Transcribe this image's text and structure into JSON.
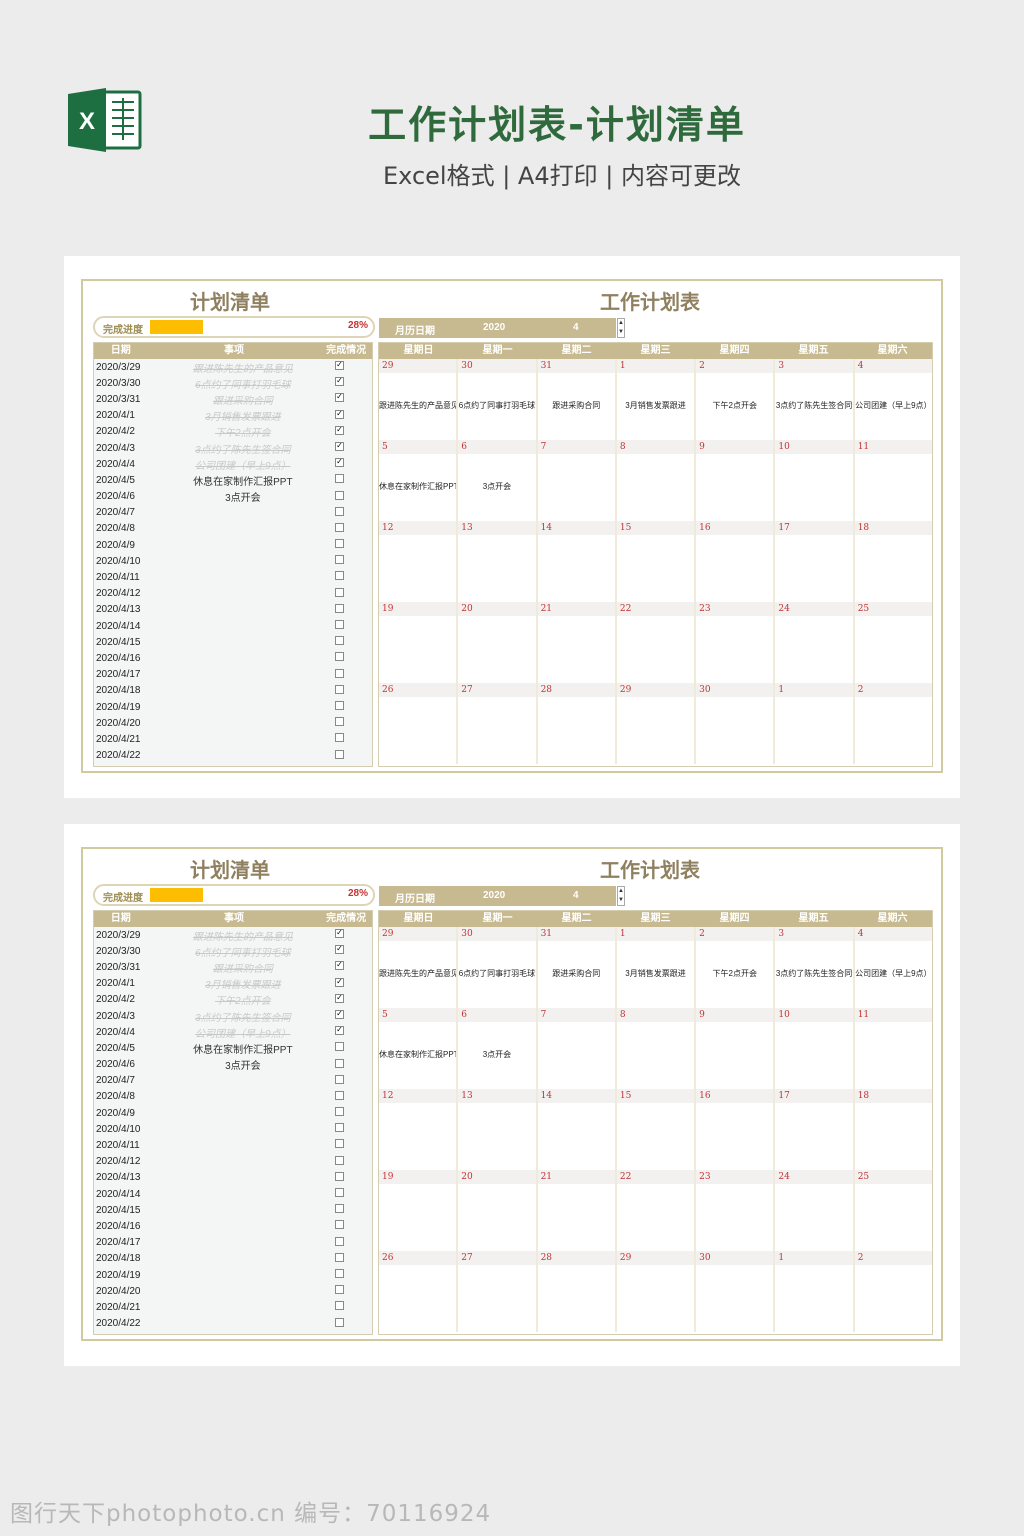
{
  "header": {
    "title": "工作计划表-计划清单",
    "subtitle": "Excel格式 | A4打印 | 内容可更改",
    "logo_icon": "excel-icon",
    "brand_color": "#1d6f42",
    "title_color": "#2e6a3c"
  },
  "watermark": "图行天下photophoto.cn 编号：70116924",
  "sheet": {
    "plan_title": "计划清单",
    "work_title": "工作计划表",
    "progress_label": "完成进度",
    "progress_value": 0.28,
    "progress_text": "28%",
    "month_label": "月历日期",
    "year": "2020",
    "month": "4",
    "plan_headers": [
      "日期",
      "事项",
      "完成情况"
    ],
    "weekdays": [
      "星期日",
      "星期一",
      "星期二",
      "星期三",
      "星期四",
      "星期五",
      "星期六"
    ],
    "rows": [
      {
        "date": "2020/3/29",
        "item": "跟进陈先生的产品意见",
        "done": true
      },
      {
        "date": "2020/3/30",
        "item": "6点约了同事打羽毛球",
        "done": true
      },
      {
        "date": "2020/3/31",
        "item": "跟进采购合同",
        "done": true
      },
      {
        "date": "2020/4/1",
        "item": "3月销售发票跟进",
        "done": true
      },
      {
        "date": "2020/4/2",
        "item": "下午2点开会",
        "done": true
      },
      {
        "date": "2020/4/3",
        "item": "3点约了陈先生签合同",
        "done": true
      },
      {
        "date": "2020/4/4",
        "item": "公司团建（早上9点）",
        "done": true
      },
      {
        "date": "2020/4/5",
        "item": "休息在家制作汇报PPT",
        "done": false
      },
      {
        "date": "2020/4/6",
        "item": "3点开会",
        "done": false
      },
      {
        "date": "2020/4/7",
        "item": "",
        "done": false
      },
      {
        "date": "2020/4/8",
        "item": "",
        "done": false
      },
      {
        "date": "2020/4/9",
        "item": "",
        "done": false
      },
      {
        "date": "2020/4/10",
        "item": "",
        "done": false
      },
      {
        "date": "2020/4/11",
        "item": "",
        "done": false
      },
      {
        "date": "2020/4/12",
        "item": "",
        "done": false
      },
      {
        "date": "2020/4/13",
        "item": "",
        "done": false
      },
      {
        "date": "2020/4/14",
        "item": "",
        "done": false
      },
      {
        "date": "2020/4/15",
        "item": "",
        "done": false
      },
      {
        "date": "2020/4/16",
        "item": "",
        "done": false
      },
      {
        "date": "2020/4/17",
        "item": "",
        "done": false
      },
      {
        "date": "2020/4/18",
        "item": "",
        "done": false
      },
      {
        "date": "2020/4/19",
        "item": "",
        "done": false
      },
      {
        "date": "2020/4/20",
        "item": "",
        "done": false
      },
      {
        "date": "2020/4/21",
        "item": "",
        "done": false
      },
      {
        "date": "2020/4/22",
        "item": "",
        "done": false
      }
    ],
    "calendar": [
      [
        {
          "day": "29",
          "note": "跟进陈先生的产品意见"
        },
        {
          "day": "30",
          "note": "6点约了同事打羽毛球"
        },
        {
          "day": "31",
          "note": "跟进采购合同"
        },
        {
          "day": "1",
          "note": "3月销售发票跟进"
        },
        {
          "day": "2",
          "note": "下午2点开会"
        },
        {
          "day": "3",
          "note": "3点约了陈先生签合同"
        },
        {
          "day": "4",
          "note": "公司团建（早上9点）"
        }
      ],
      [
        {
          "day": "5",
          "note": "休息在家制作汇报PPT"
        },
        {
          "day": "6",
          "note": "3点开会"
        },
        {
          "day": "7",
          "note": ""
        },
        {
          "day": "8",
          "note": ""
        },
        {
          "day": "9",
          "note": ""
        },
        {
          "day": "10",
          "note": ""
        },
        {
          "day": "11",
          "note": ""
        }
      ],
      [
        {
          "day": "12",
          "note": ""
        },
        {
          "day": "13",
          "note": ""
        },
        {
          "day": "14",
          "note": ""
        },
        {
          "day": "15",
          "note": ""
        },
        {
          "day": "16",
          "note": ""
        },
        {
          "day": "17",
          "note": ""
        },
        {
          "day": "18",
          "note": ""
        }
      ],
      [
        {
          "day": "19",
          "note": ""
        },
        {
          "day": "20",
          "note": ""
        },
        {
          "day": "21",
          "note": ""
        },
        {
          "day": "22",
          "note": ""
        },
        {
          "day": "23",
          "note": ""
        },
        {
          "day": "24",
          "note": ""
        },
        {
          "day": "25",
          "note": ""
        }
      ],
      [
        {
          "day": "26",
          "note": ""
        },
        {
          "day": "27",
          "note": ""
        },
        {
          "day": "28",
          "note": ""
        },
        {
          "day": "29",
          "note": ""
        },
        {
          "day": "30",
          "note": ""
        },
        {
          "day": "1",
          "note": ""
        },
        {
          "day": "2",
          "note": ""
        }
      ]
    ],
    "colors": {
      "header_tan": "#c7b990",
      "title_tan": "#8f8060",
      "progress_fill": "#fdbd00",
      "percent_red": "#c83232",
      "day_red": "#c33434"
    }
  }
}
